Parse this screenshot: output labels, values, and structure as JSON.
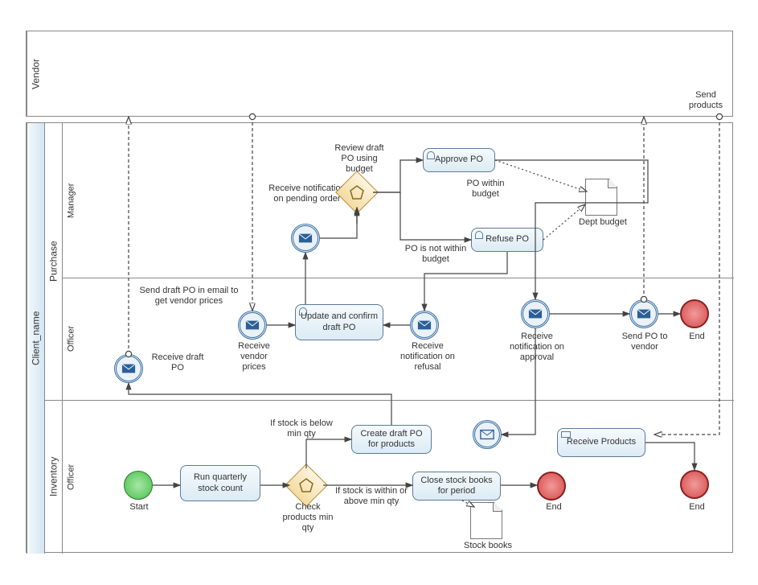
{
  "pools": {
    "vendor": "Vendor",
    "client": "Client_name",
    "purchase": "Purchase",
    "manager": "Manager",
    "officer_purchase": "Officer",
    "inventory": "Inventory",
    "officer_inventory": "Officer"
  },
  "labels": {
    "send_products": "Send products",
    "review_budget": "Review draft PO using budget",
    "recv_pending": "Receive notification on pending order",
    "dept_budget": "Dept budget",
    "approve_po": "Approve PO",
    "refuse_po": "Refuse PO",
    "within_budget": "PO within budget",
    "not_within": "PO is not within budget",
    "send_draft_prices": "Send draft PO in email to get vendor prices",
    "recv_vendor_prices": "Receive vendor prices",
    "recv_draft_po": "Receive draft PO",
    "update_confirm": "Update and confirm draft PO",
    "recv_refusal": "Receive notification on refusal",
    "recv_approval": "Receive notification on approval",
    "send_vendor": "Send PO to vendor",
    "end": "End",
    "start": "Start",
    "run_quarterly": "Run quarterly stock count",
    "check_min": "Check products min qty",
    "below_min": "If stock is below min qty",
    "within_min": "If stock is within or above min qty",
    "create_draft": "Create draft PO for products",
    "close_stock": "Close stock books for period",
    "stock_books": "Stock books",
    "receive_products": "Receive Products"
  }
}
